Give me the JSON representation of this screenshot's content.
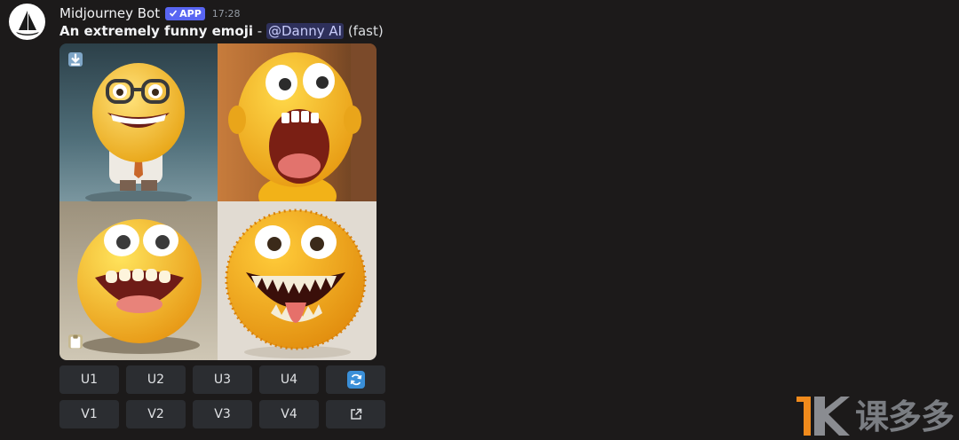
{
  "message": {
    "username": "Midjourney Bot",
    "badge": "APP",
    "timestamp": "17:28",
    "prompt_bold": "An extremely funny emoji",
    "separator": " - ",
    "mention": "@Danny AI",
    "speed": " (fast)"
  },
  "images": [
    {
      "name": "emoji-with-glasses"
    },
    {
      "name": "emoji-screaming"
    },
    {
      "name": "emoji-laughing-ball"
    },
    {
      "name": "emoji-orange-tongue"
    }
  ],
  "buttons": {
    "upscale": [
      "U1",
      "U2",
      "U3",
      "U4"
    ],
    "variation": [
      "V1",
      "V2",
      "V3",
      "V4"
    ],
    "reroll_icon": "refresh-icon",
    "web_icon": "external-link-icon"
  },
  "watermark": {
    "text": "课多多"
  },
  "colors": {
    "background": "#1c1a1a",
    "button": "#2b2d31",
    "badge": "#5865f2",
    "reroll": "#3a8fd8",
    "watermark_accent": "#f08a1c"
  }
}
